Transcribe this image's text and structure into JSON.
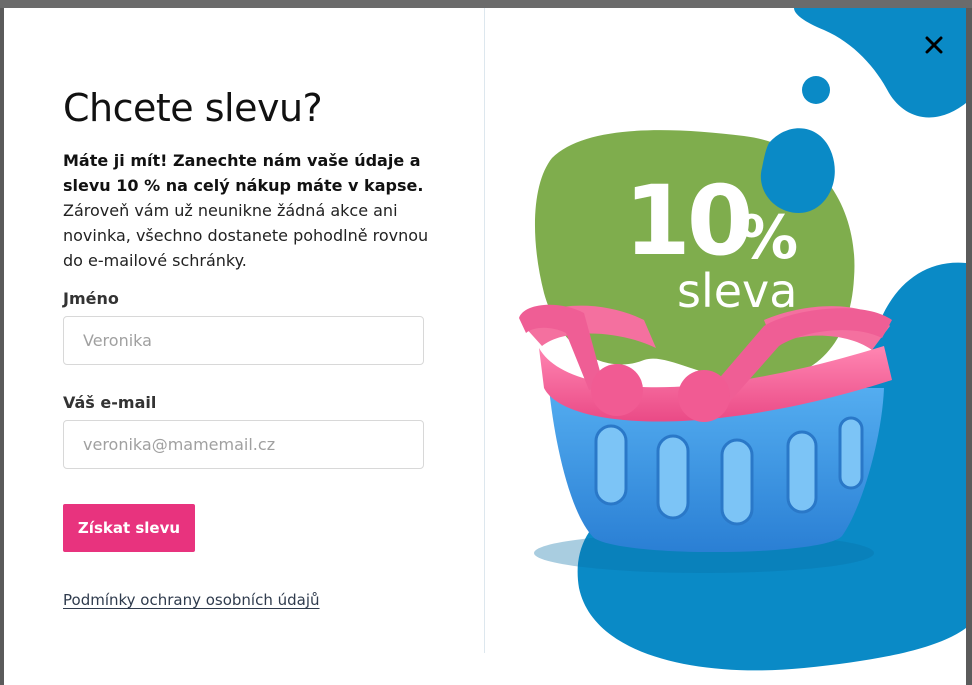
{
  "popup": {
    "title": "Chcete slevu?",
    "intro_bold": "Máte ji mít! Zanechte nám vaše údaje a slevu 10 % na celý nákup máte v kapse.",
    "intro_text": "Zároveň vám už neunikne žádná akce ani novinka, všechno dostanete pohodlně rovnou do e-mailové schránky.",
    "name_label": "Jméno",
    "name_placeholder": "Veronika",
    "email_label": "Váš e-mail",
    "email_placeholder": "veronika@mamemail.cz",
    "submit_label": "Získat slevu",
    "privacy_link": "Podmínky ochrany osobních údajů",
    "close_icon": "close-icon"
  },
  "promo": {
    "amount": "10",
    "percent": "%",
    "word": "sleva",
    "basket_icon": "shopping-basket-icon"
  },
  "colors": {
    "accent": "#e8337e",
    "blob_blue": "#0a8ac6",
    "blob_green": "#7fad4d",
    "basket_blue": "#3f9ae3",
    "basket_pink": "#f15b93"
  }
}
